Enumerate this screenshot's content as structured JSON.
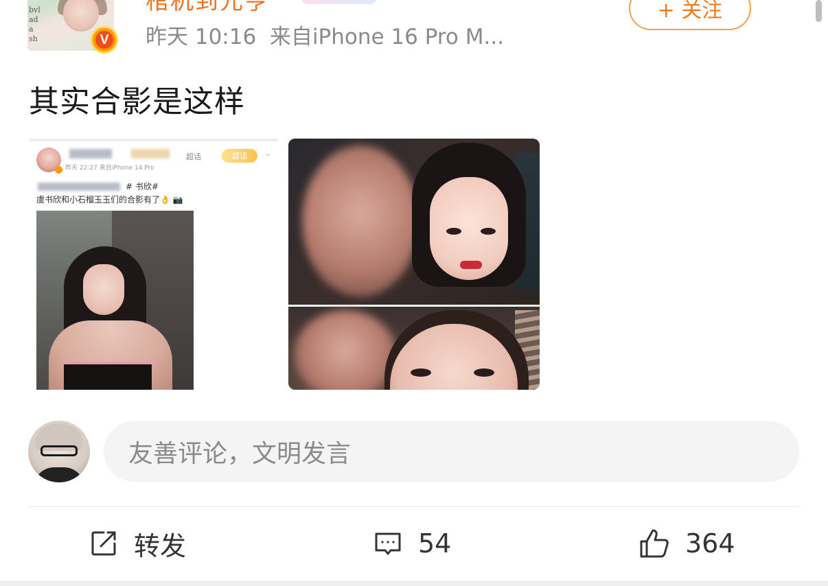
{
  "post": {
    "username": "棺杌到元亨",
    "time": "昨天 10:16",
    "source": "来自iPhone 16 Pro M...",
    "follow_label": "+ 关注",
    "text": "其实合影是这样",
    "avatar_text": "bvl\nad\na\nsh"
  },
  "embedded_screenshot": {
    "meta": "昨天 22:27  来自iPhone 14 Pro",
    "chaohua": "超话",
    "tag": "超话",
    "line1": "#         书欣#",
    "line2": "虞书欣和小石榴玉玉们的合影有了👌 📷"
  },
  "comment_bar": {
    "placeholder": "友善评论，文明发言"
  },
  "actions": {
    "repost_label": "转发",
    "comment_count": "54",
    "like_count": "364"
  },
  "colors": {
    "accent": "#f2731f",
    "follow_border": "#f5a04a",
    "meta_gray": "#8a8a8a",
    "input_bg": "#f4f4f4"
  },
  "icons": [
    "verified-badge-icon",
    "repost-icon",
    "comment-icon",
    "like-icon"
  ]
}
